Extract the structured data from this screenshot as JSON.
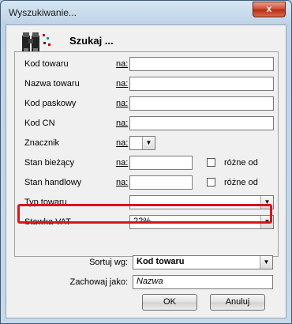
{
  "window": {
    "title": "Wyszukiwanie...",
    "close_label": "x"
  },
  "header": {
    "title": "Szukaj ..."
  },
  "fields": [
    {
      "label": "Kod towaru",
      "prefix": "na:",
      "value": ""
    },
    {
      "label": "Nazwa towaru",
      "prefix": "na:",
      "value": ""
    },
    {
      "label": "Kod paskowy",
      "prefix": "na:",
      "value": ""
    },
    {
      "label": "Kod CN",
      "prefix": "na:",
      "value": ""
    },
    {
      "label": "Znacznik",
      "prefix": "na:",
      "value": ""
    },
    {
      "label": "Stan bieżący",
      "prefix": "na:",
      "value": "",
      "checkbox_label": "różne od",
      "checked": false
    },
    {
      "label": "Stan handlowy",
      "prefix": "na:",
      "value": "",
      "checkbox_label": "różne od",
      "checked": false
    },
    {
      "label": "Typ towaru",
      "value": ""
    },
    {
      "label": "Stawka VAT",
      "value": "22%"
    }
  ],
  "sort": {
    "label": "Sortuj wg:",
    "value": "Kod towaru"
  },
  "save_as": {
    "label": "Zachowaj jako:",
    "value": "Nazwa"
  },
  "buttons": {
    "ok": "OK",
    "cancel": "Anuluj"
  }
}
